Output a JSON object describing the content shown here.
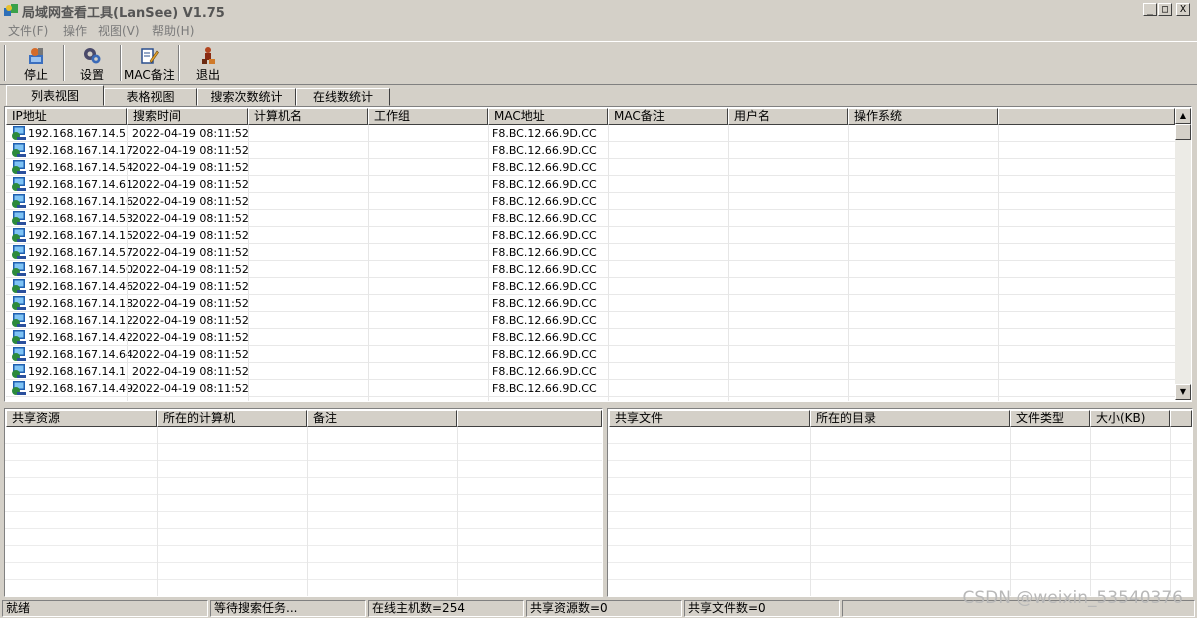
{
  "window": {
    "title": "局域网查看工具(LanSee) V1.75",
    "minimize": "_",
    "maximize": "□",
    "close": "X"
  },
  "menu": [
    "文件(F)",
    "操作",
    "视图(V)",
    "帮助(H)"
  ],
  "toolbar": [
    {
      "label": "停止",
      "icon": "stop-icon"
    },
    {
      "label": "设置",
      "icon": "settings-icon"
    },
    {
      "label": "MAC备注",
      "icon": "edit-note-icon"
    },
    {
      "label": "退出",
      "icon": "exit-icon"
    }
  ],
  "tabs": [
    "列表视图",
    "表格视图",
    "搜索次数统计",
    "在线数统计"
  ],
  "active_tab": "列表视图",
  "hosts": {
    "columns": [
      "IP地址",
      "搜索时间",
      "计算机名",
      "工作组",
      "MAC地址",
      "MAC备注",
      "用户名",
      "操作系统"
    ],
    "rows": [
      [
        "192.168.167.14.5",
        "2022-04-19 08:11:52",
        "",
        "",
        "F8.BC.12.66.9D.CC",
        "",
        "",
        ""
      ],
      [
        "192.168.167.14.17",
        "2022-04-19 08:11:52",
        "",
        "",
        "F8.BC.12.66.9D.CC",
        "",
        "",
        ""
      ],
      [
        "192.168.167.14.54",
        "2022-04-19 08:11:52",
        "",
        "",
        "F8.BC.12.66.9D.CC",
        "",
        "",
        ""
      ],
      [
        "192.168.167.14.61",
        "2022-04-19 08:11:52",
        "",
        "",
        "F8.BC.12.66.9D.CC",
        "",
        "",
        ""
      ],
      [
        "192.168.167.14.16",
        "2022-04-19 08:11:52",
        "",
        "",
        "F8.BC.12.66.9D.CC",
        "",
        "",
        ""
      ],
      [
        "192.168.167.14.53",
        "2022-04-19 08:11:52",
        "",
        "",
        "F8.BC.12.66.9D.CC",
        "",
        "",
        ""
      ],
      [
        "192.168.167.14.15",
        "2022-04-19 08:11:52",
        "",
        "",
        "F8.BC.12.66.9D.CC",
        "",
        "",
        ""
      ],
      [
        "192.168.167.14.57",
        "2022-04-19 08:11:52",
        "",
        "",
        "F8.BC.12.66.9D.CC",
        "",
        "",
        ""
      ],
      [
        "192.168.167.14.50",
        "2022-04-19 08:11:52",
        "",
        "",
        "F8.BC.12.66.9D.CC",
        "",
        "",
        ""
      ],
      [
        "192.168.167.14.46",
        "2022-04-19 08:11:52",
        "",
        "",
        "F8.BC.12.66.9D.CC",
        "",
        "",
        ""
      ],
      [
        "192.168.167.14.18",
        "2022-04-19 08:11:52",
        "",
        "",
        "F8.BC.12.66.9D.CC",
        "",
        "",
        ""
      ],
      [
        "192.168.167.14.12",
        "2022-04-19 08:11:52",
        "",
        "",
        "F8.BC.12.66.9D.CC",
        "",
        "",
        ""
      ],
      [
        "192.168.167.14.42",
        "2022-04-19 08:11:52",
        "",
        "",
        "F8.BC.12.66.9D.CC",
        "",
        "",
        ""
      ],
      [
        "192.168.167.14.64",
        "2022-04-19 08:11:52",
        "",
        "",
        "F8.BC.12.66.9D.CC",
        "",
        "",
        ""
      ],
      [
        "192.168.167.14.1",
        "2022-04-19 08:11:52",
        "",
        "",
        "F8.BC.12.66.9D.CC",
        "",
        "",
        ""
      ],
      [
        "192.168.167.14.49",
        "2022-04-19 08:11:52",
        "",
        "",
        "F8.BC.12.66.9D.CC",
        "",
        "",
        ""
      ]
    ]
  },
  "shares": {
    "columns": [
      "共享资源",
      "所在的计算机",
      "备注",
      ""
    ]
  },
  "files": {
    "columns": [
      "共享文件",
      "所在的目录",
      "文件类型",
      "大小(KB)"
    ]
  },
  "status": [
    "就绪",
    "等待搜索任务...",
    "在线主机数=254",
    "共享资源数=0",
    "共享文件数=0",
    ""
  ],
  "watermark": "CSDN @weixin_53540376",
  "colors": {
    "window_bg": "#d4d0c8",
    "list_bg": "#ffffff",
    "title_text": "#555555",
    "menu_text": "#7a7a7a"
  }
}
